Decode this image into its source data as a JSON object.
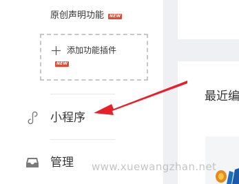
{
  "sidebar": {
    "original_statement": {
      "label": "原创声明功能",
      "badge": "NEW"
    },
    "add_plugin": {
      "label": "添加功能插件",
      "badge": "NEW"
    },
    "items": [
      {
        "label": "小程序",
        "icon": "link-icon"
      },
      {
        "label": "管理",
        "icon": "inbox-icon"
      }
    ]
  },
  "content": {
    "section_title": "最近编"
  },
  "watermark": "www.xuewangzhan.net",
  "colors": {
    "badge": "#e2492d",
    "annotation_arrow": "#e8202a",
    "text": "#353535",
    "page_background": "#eef0f4"
  }
}
